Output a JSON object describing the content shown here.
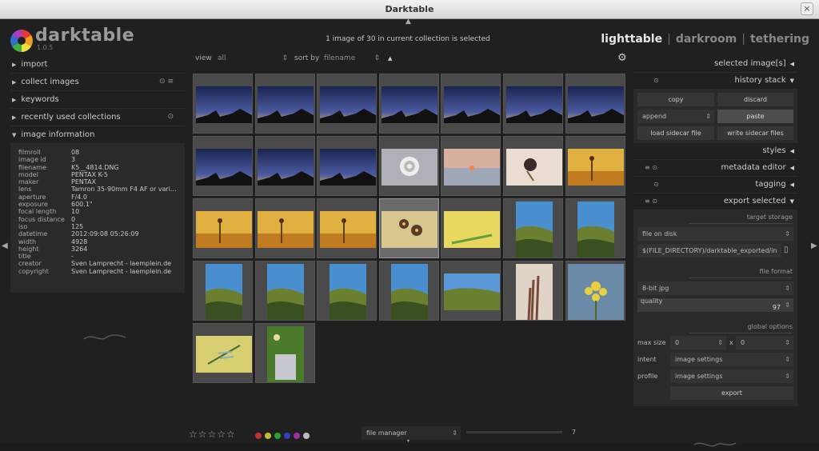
{
  "window": {
    "title": "Darktable",
    "close": "×"
  },
  "logo": {
    "name": "darktable",
    "version": "1.0.5"
  },
  "collection_status": "1 image of 30 in current collection is selected",
  "views": {
    "lighttable": "lighttable",
    "darkroom": "darkroom",
    "tethering": "tethering",
    "sep": "|"
  },
  "left_panel": {
    "sections": [
      {
        "label": "import",
        "icon": ""
      },
      {
        "label": "collect images",
        "icon": "⊙ ≡"
      },
      {
        "label": "keywords",
        "icon": ""
      },
      {
        "label": "recently used collections",
        "icon": "⊙"
      }
    ],
    "image_information": {
      "label": "image information",
      "rows": [
        {
          "k": "filmroll",
          "v": "08"
        },
        {
          "k": "image id",
          "v": "3"
        },
        {
          "k": "filename",
          "v": "K5__4814.DNG"
        },
        {
          "k": "model",
          "v": "PENTAX K-5"
        },
        {
          "k": "maker",
          "v": "PENTAX"
        },
        {
          "k": "lens",
          "v": "Tamron 35-90mm F4 AF or vari..."
        },
        {
          "k": "aperture",
          "v": "F/4.0"
        },
        {
          "k": "exposure",
          "v": "600.1\""
        },
        {
          "k": "focal length",
          "v": "10"
        },
        {
          "k": "focus distance",
          "v": "0"
        },
        {
          "k": "iso",
          "v": "125"
        },
        {
          "k": "datetime",
          "v": "2012:09:08 05:26:09"
        },
        {
          "k": "width",
          "v": "4928"
        },
        {
          "k": "height",
          "v": "3264"
        },
        {
          "k": "title",
          "v": "-"
        },
        {
          "k": "creator",
          "v": "Sven Lamprecht - laemplein.de"
        },
        {
          "k": "copyright",
          "v": "Sven Lamprecht - laemplein.de"
        }
      ]
    }
  },
  "filter_bar": {
    "view_label": "view",
    "view_value": "all",
    "sort_label": "sort by",
    "sort_value": "filename"
  },
  "right_panel": {
    "selected_images": "selected image[s]",
    "history_stack": "history stack",
    "copy": "copy",
    "discard": "discard",
    "append": "append",
    "paste": "paste",
    "load_sidecar": "load sidecar file",
    "write_sidecar": "write sidecar files",
    "styles": "styles",
    "metadata_editor": "metadata editor",
    "tagging": "tagging",
    "export_selected": "export selected",
    "target_storage": "target storage",
    "storage_value": "file on disk",
    "path_value": "$(FILE_DIRECTORY)/darktable_exported/in",
    "file_format": "file format",
    "format_value": "8-bit jpg",
    "quality_label": "quality",
    "quality_value": "97",
    "global_options": "global options",
    "max_size_label": "max size",
    "max_w": "0",
    "x": "x",
    "max_h": "0",
    "intent_label": "intent",
    "intent_value": "image settings",
    "profile_label": "profile",
    "profile_value": "image settings",
    "export_button": "export"
  },
  "bottom_bar": {
    "stars": "☆☆☆☆☆",
    "layout_value": "file manager",
    "zoom_value": "7"
  },
  "color_labels": [
    "#c03030",
    "#c0c030",
    "#30a030",
    "#3040c0",
    "#a030a0",
    "#bbbbbb"
  ]
}
